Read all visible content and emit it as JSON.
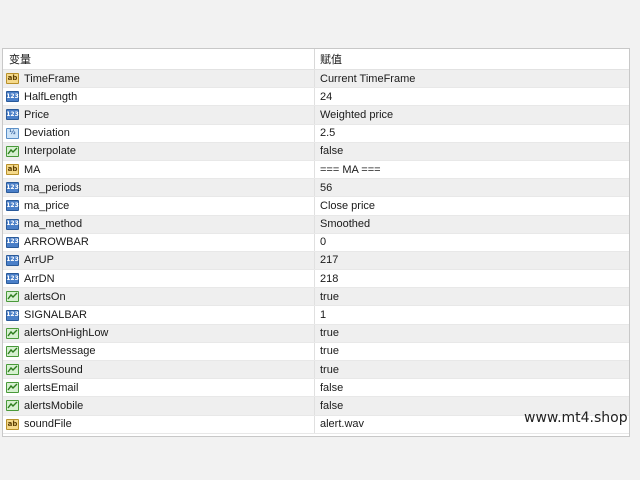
{
  "header": {
    "name_col": "变量",
    "value_col": "赋值"
  },
  "rows": [
    {
      "icon": "string-icon",
      "type": "string",
      "name": "TimeFrame",
      "value": "Current TimeFrame"
    },
    {
      "icon": "integer-icon",
      "type": "int",
      "name": "HalfLength",
      "value": "24"
    },
    {
      "icon": "integer-icon",
      "type": "int",
      "name": "Price",
      "value": "Weighted price"
    },
    {
      "icon": "double-icon",
      "type": "double",
      "name": "Deviation",
      "value": "2.5"
    },
    {
      "icon": "bool-icon",
      "type": "bool",
      "name": "Interpolate",
      "value": "false"
    },
    {
      "icon": "string-icon",
      "type": "string",
      "name": "MA",
      "value": "=== MA ==="
    },
    {
      "icon": "integer-icon",
      "type": "int",
      "name": "ma_periods",
      "value": "56"
    },
    {
      "icon": "integer-icon",
      "type": "int",
      "name": "ma_price",
      "value": "Close price"
    },
    {
      "icon": "integer-icon",
      "type": "int",
      "name": "ma_method",
      "value": "Smoothed"
    },
    {
      "icon": "integer-icon",
      "type": "int",
      "name": "ARROWBAR",
      "value": "0"
    },
    {
      "icon": "integer-icon",
      "type": "int",
      "name": "ArrUP",
      "value": "217"
    },
    {
      "icon": "integer-icon",
      "type": "int",
      "name": "ArrDN",
      "value": "218"
    },
    {
      "icon": "bool-icon",
      "type": "bool",
      "name": "alertsOn",
      "value": "true"
    },
    {
      "icon": "integer-icon",
      "type": "int",
      "name": "SIGNALBAR",
      "value": "1"
    },
    {
      "icon": "bool-icon",
      "type": "bool",
      "name": "alertsOnHighLow",
      "value": "true"
    },
    {
      "icon": "bool-icon",
      "type": "bool",
      "name": "alertsMessage",
      "value": "true"
    },
    {
      "icon": "bool-icon",
      "type": "bool",
      "name": "alertsSound",
      "value": "true"
    },
    {
      "icon": "bool-icon",
      "type": "bool",
      "name": "alertsEmail",
      "value": "false"
    },
    {
      "icon": "bool-icon",
      "type": "bool",
      "name": "alertsMobile",
      "value": "false"
    },
    {
      "icon": "string-icon",
      "type": "string",
      "name": "soundFile",
      "value": "alert.wav"
    }
  ],
  "icon_glyphs": {
    "string": "ab",
    "int": "123",
    "double": "½"
  },
  "watermark": "www.mt4.shop"
}
